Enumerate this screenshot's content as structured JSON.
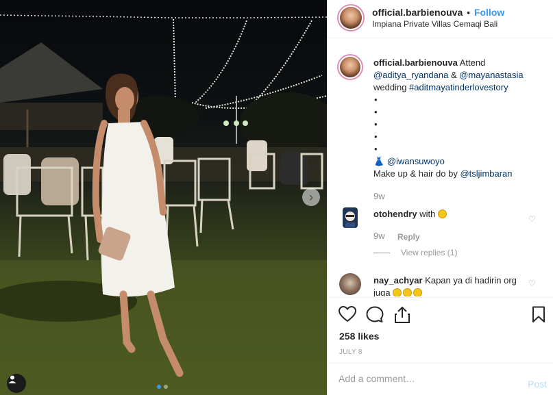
{
  "post": {
    "username": "official.barbienouva",
    "separator": "•",
    "follow_label": "Follow",
    "location": "Impiana Private Villas Cemaqi Bali"
  },
  "caption": {
    "username": "official.barbienouva",
    "text1": " Attend ",
    "mention1": "@aditya_ryandana",
    "amp": " & ",
    "mention2": "@mayanastasia",
    "text2": "wedding ",
    "hashtag": "#aditmayatinderlovestory",
    "bullets": [
      "•",
      "•",
      "•",
      "•",
      "•"
    ],
    "dress_emoji": "👗",
    "mention3": "@iwansuwoyo",
    "makeup_text": "Make up & hair do by ",
    "mention4": "@tsljimbaran",
    "time": "9w"
  },
  "comments": [
    {
      "username": "otohendry",
      "text": " with ",
      "time": "9w",
      "reply_label": "Reply",
      "view_replies": "View replies (1)"
    },
    {
      "username": "nay_achyar",
      "text": " Kapan ya di hadirin org juga "
    }
  ],
  "likes_text": "258 likes",
  "date_text": "JULY 8",
  "add_comment": {
    "placeholder": "Add a comment…",
    "post_label": "Post"
  },
  "colors": {
    "link": "#003569",
    "follow": "#3897f0",
    "post_disabled": "#b2dffc"
  }
}
